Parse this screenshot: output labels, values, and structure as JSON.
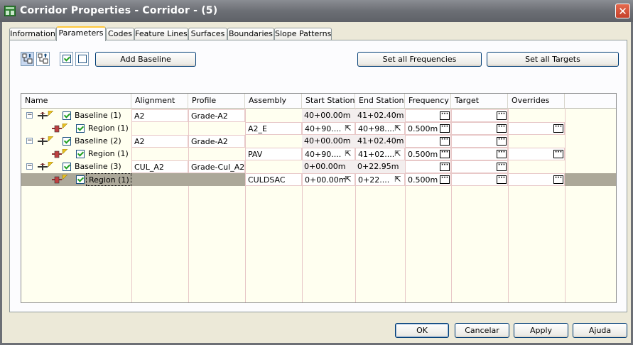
{
  "window": {
    "title": "Corridor Properties - Corridor - (5)",
    "close_glyph": "✕"
  },
  "tabs": [
    {
      "label": "Information"
    },
    {
      "label": "Parameters"
    },
    {
      "label": "Codes"
    },
    {
      "label": "Feature Lines"
    },
    {
      "label": "Surfaces"
    },
    {
      "label": "Boundaries"
    },
    {
      "label": "Slope Patterns"
    }
  ],
  "toolbar": {
    "add_baseline": "Add Baseline",
    "set_all_frequencies": "Set all Frequencies",
    "set_all_targets": "Set all Targets"
  },
  "grid": {
    "headers": [
      "Name",
      "Alignment",
      "Profile",
      "Assembly",
      "Start Station",
      "End Station",
      "Frequency",
      "Target",
      "Overrides"
    ],
    "rows": [
      {
        "name": "Baseline (1)",
        "alignment": "A2",
        "profile": "Grade-A2",
        "assembly": "",
        "start": "40+00.00m",
        "end": "41+02.40m",
        "frequency": ""
      },
      {
        "name": "Region (1)",
        "alignment": "",
        "profile": "",
        "assembly": "A2_E",
        "start": "40+90....",
        "end": "40+98....",
        "frequency": "0.500m"
      },
      {
        "name": "Baseline (2)",
        "alignment": "A2",
        "profile": "Grade-A2",
        "assembly": "",
        "start": "40+00.00m",
        "end": "41+02.40m",
        "frequency": ""
      },
      {
        "name": "Region (1)",
        "alignment": "",
        "profile": "",
        "assembly": "PAV",
        "start": "40+90....",
        "end": "41+02....",
        "frequency": "0.500m"
      },
      {
        "name": "Baseline (3)",
        "alignment": "CUL_A2",
        "profile": "Grade-Cul_A2",
        "assembly": "",
        "start": "0+00.00m",
        "end": "0+22.95m",
        "frequency": ""
      },
      {
        "name": "Region (1)",
        "alignment": "",
        "profile": "",
        "assembly": "CULDSAC",
        "start": "0+00.00m",
        "end": "0+22....",
        "frequency": "0.500m"
      }
    ]
  },
  "footer": {
    "ok": "OK",
    "cancel": "Cancelar",
    "apply": "Apply",
    "help": "Ajuda"
  },
  "glyphs": {
    "ellipsis": "···",
    "tree_minus": "−",
    "pick": "⇱"
  }
}
